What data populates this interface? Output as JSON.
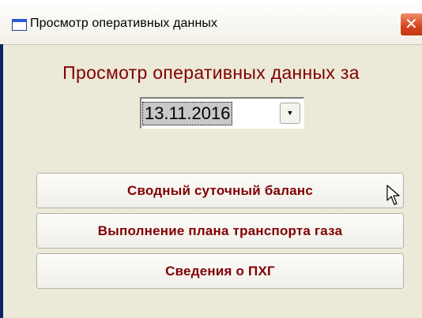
{
  "window": {
    "title": "Просмотр оперативных данных",
    "icons": {
      "app": "window-icon",
      "close": "close-icon"
    }
  },
  "main": {
    "heading": "Просмотр оперативных данных за",
    "date": {
      "value": "13.11.2016",
      "dropdown_icon": "chevron-down-icon"
    },
    "buttons": [
      {
        "label": "Сводный суточный баланс"
      },
      {
        "label": "Выполнение плана транспорта газа"
      },
      {
        "label": "Сведения о ПХГ"
      }
    ]
  },
  "colors": {
    "accent_text": "#800000",
    "close_button": "#d4451e",
    "dialog_background": "#ece9d8"
  }
}
